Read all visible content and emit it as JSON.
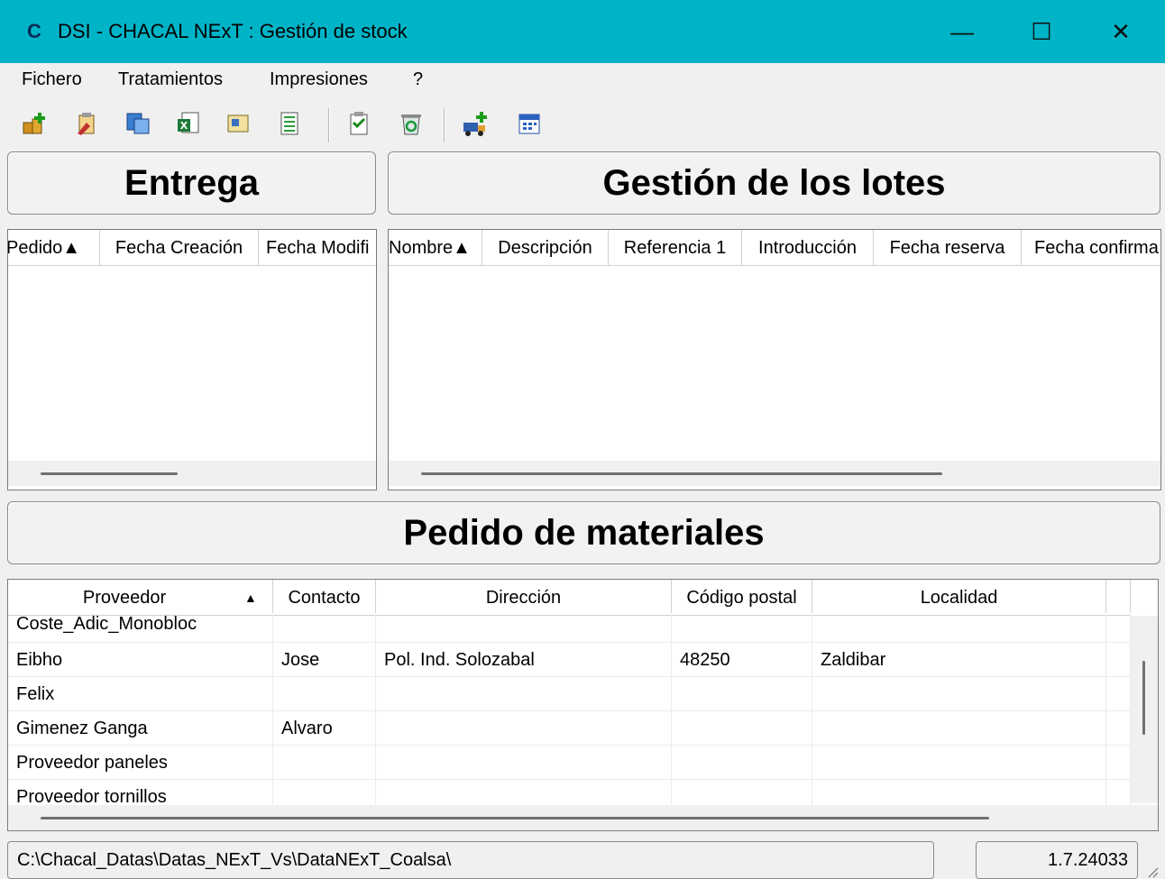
{
  "window": {
    "title": "DSI - CHACAL NExT : Gestión de stock",
    "app_icon_glyph": "C",
    "minimize_glyph": "—",
    "maximize_glyph": "☐",
    "close_glyph": "✕",
    "accent_color": "#00b4c8"
  },
  "menu": {
    "items": [
      "Fichero",
      "Tratamientos",
      "Impresiones",
      "?"
    ]
  },
  "toolbar": {
    "icons": [
      "add-stock-icon",
      "edit-stock-icon",
      "transfer-icon",
      "excel-export-icon",
      "inventory-icon",
      "list-icon",
      "report-icon",
      "recycle-icon",
      "truck-add-icon",
      "calendar-icon"
    ]
  },
  "entrega": {
    "title": "Entrega",
    "columns": [
      "Pedido▲",
      "Fecha Creación",
      "Fecha Modifi"
    ]
  },
  "lotes": {
    "title": "Gestión de los lotes",
    "columns": [
      "Nombre▲",
      "Descripción",
      "Referencia 1",
      "Introducción",
      "Fecha reserva",
      "Fecha confirma"
    ]
  },
  "pedido": {
    "title": "Pedido de materiales",
    "columns": [
      "Proveedor",
      "Contacto",
      "Dirección",
      "Código postal",
      "Localidad"
    ],
    "sort_arrow": "▲",
    "rows": [
      {
        "proveedor": "Coste_Adic_Monobloc",
        "contacto": "",
        "direccion": "",
        "cp": "",
        "localidad": ""
      },
      {
        "proveedor": "Eibho",
        "contacto": "Jose",
        "direccion": "Pol. Ind. Solozabal",
        "cp": "48250",
        "localidad": "Zaldibar"
      },
      {
        "proveedor": "Felix",
        "contacto": "",
        "direccion": "",
        "cp": "",
        "localidad": ""
      },
      {
        "proveedor": "Gimenez Ganga",
        "contacto": "Alvaro",
        "direccion": "",
        "cp": "",
        "localidad": ""
      },
      {
        "proveedor": "Proveedor paneles",
        "contacto": "",
        "direccion": "",
        "cp": "",
        "localidad": ""
      },
      {
        "proveedor": "Proveedor tornillos",
        "contacto": "",
        "direccion": "",
        "cp": "",
        "localidad": ""
      }
    ]
  },
  "status": {
    "path": "C:\\Chacal_Datas\\Datas_NExT_Vs\\DataNExT_Coalsa\\",
    "version": "1.7.24033"
  }
}
